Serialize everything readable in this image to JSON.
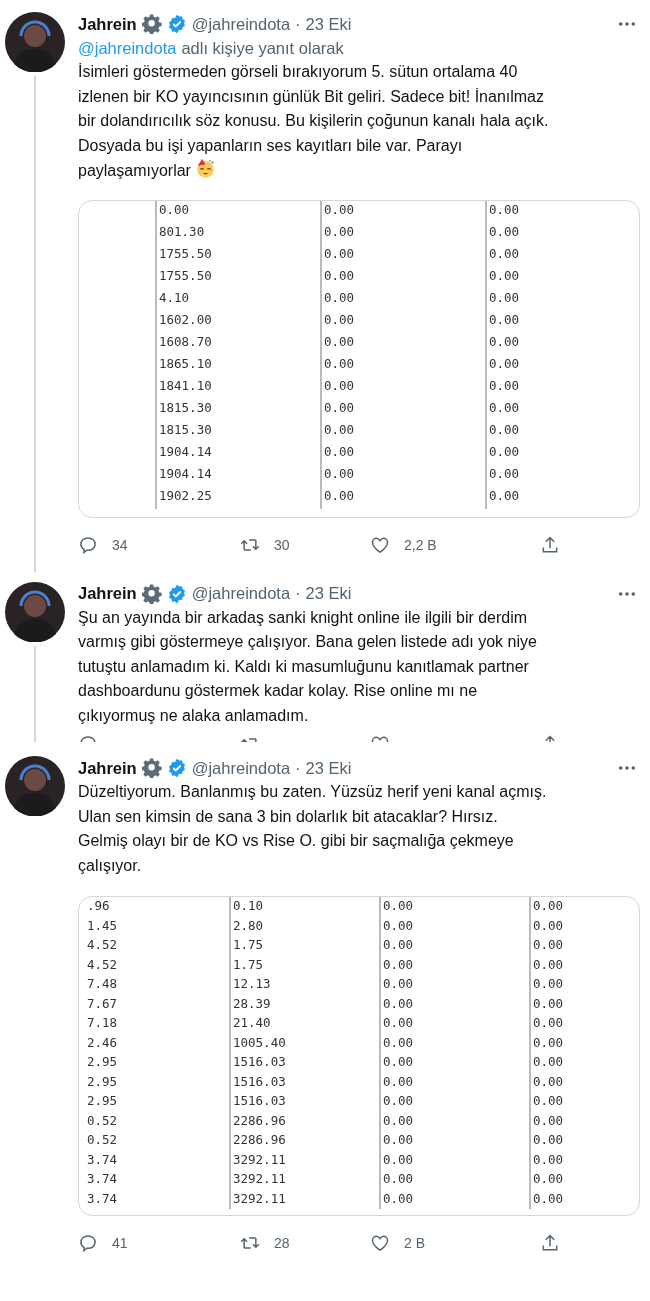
{
  "tweets": [
    {
      "author": "Jahrein",
      "handle": "@jahreindota",
      "separator": "·",
      "date": "23 Eki",
      "thread_line": true,
      "reply_to": {
        "handle": "@jahreindota",
        "text": "adlı kişiye yanıt olarak"
      },
      "body": "İsimleri göstermeden görseli bırakıyorum 5. sütun ortalama 40\nizlenen bir KO yayıncısının günlük Bit geliri. Sadece bit! İnanılmaz\nbir dolandırıcılık söz konusu. Bu kişilerin çoğunun kanalı hala açık.\nDosyada bu işi yapanların ses kayıtları bile var. Parayı\npaylaşamıyorlar",
      "party_emoji": true,
      "media": {
        "kind": "table",
        "rows": [
          [
            "0.00",
            "0.00",
            "0.00"
          ],
          [
            "801.30",
            "0.00",
            "0.00"
          ],
          [
            "1755.50",
            "0.00",
            "0.00"
          ],
          [
            "1755.50",
            "0.00",
            "0.00"
          ],
          [
            "4.10",
            "0.00",
            "0.00"
          ],
          [
            "1602.00",
            "0.00",
            "0.00"
          ],
          [
            "1608.70",
            "0.00",
            "0.00"
          ],
          [
            "1865.10",
            "0.00",
            "0.00"
          ],
          [
            "1841.10",
            "0.00",
            "0.00"
          ],
          [
            "1815.30",
            "0.00",
            "0.00"
          ],
          [
            "1815.30",
            "0.00",
            "0.00"
          ],
          [
            "1904.14",
            "0.00",
            "0.00"
          ],
          [
            "1904.14",
            "0.00",
            "0.00"
          ],
          [
            "1902.25",
            "0.00",
            "0.00"
          ]
        ]
      },
      "stats": {
        "replies": "34",
        "retweets": "30",
        "likes": "2,2 B"
      }
    },
    {
      "author": "Jahrein",
      "handle": "@jahreindota",
      "separator": "·",
      "date": "23 Eki",
      "thread_line": true,
      "body": "Şu an yayında bir arkadaş sanki knight online ile ilgili bir derdim\nvarmış gibi göstermeye çalışıyor. Bana gelen listede adı yok niye\ntutuştu anlamadım ki. Kaldı ki masumluğunu kanıtlamak partner\ndashboardunu göstermek kadar kolay. Rise online mı ne\nçıkıyormuş ne alaka anlamadım.",
      "actions_cut": true
    },
    {
      "author": "Jahrein",
      "handle": "@jahreindota",
      "separator": "·",
      "date": "23 Eki",
      "thread_line": false,
      "body": "Düzeltiyorum. Banlanmış bu zaten. Yüzsüz herif yeni kanal açmış.\nUlan sen kimsin de sana 3 bin dolarlık bit atacaklar? Hırsız.\nGelmiş olayı bir de KO vs Rise O. gibi bir saçmalığa çekmeye\nçalışıyor.",
      "media": {
        "kind": "table",
        "rows": [
          [
            ".96",
            "0.10",
            "0.00",
            "0.00"
          ],
          [
            "1.45",
            "2.80",
            "0.00",
            "0.00"
          ],
          [
            "4.52",
            "1.75",
            "0.00",
            "0.00"
          ],
          [
            "4.52",
            "1.75",
            "0.00",
            "0.00"
          ],
          [
            "7.48",
            "12.13",
            "0.00",
            "0.00"
          ],
          [
            "7.67",
            "28.39",
            "0.00",
            "0.00"
          ],
          [
            "7.18",
            "21.40",
            "0.00",
            "0.00"
          ],
          [
            "2.46",
            "1005.40",
            "0.00",
            "0.00"
          ],
          [
            "2.95",
            "1516.03",
            "0.00",
            "0.00"
          ],
          [
            "2.95",
            "1516.03",
            "0.00",
            "0.00"
          ],
          [
            "2.95",
            "1516.03",
            "0.00",
            "0.00"
          ],
          [
            "0.52",
            "2286.96",
            "0.00",
            "0.00"
          ],
          [
            "0.52",
            "2286.96",
            "0.00",
            "0.00"
          ],
          [
            "3.74",
            "3292.11",
            "0.00",
            "0.00"
          ],
          [
            "3.74",
            "3292.11",
            "0.00",
            "0.00"
          ],
          [
            "3.74",
            "3292.11",
            "0.00",
            "0.00"
          ]
        ]
      },
      "stats": {
        "replies": "41",
        "retweets": "28",
        "likes": "2 B"
      }
    }
  ]
}
